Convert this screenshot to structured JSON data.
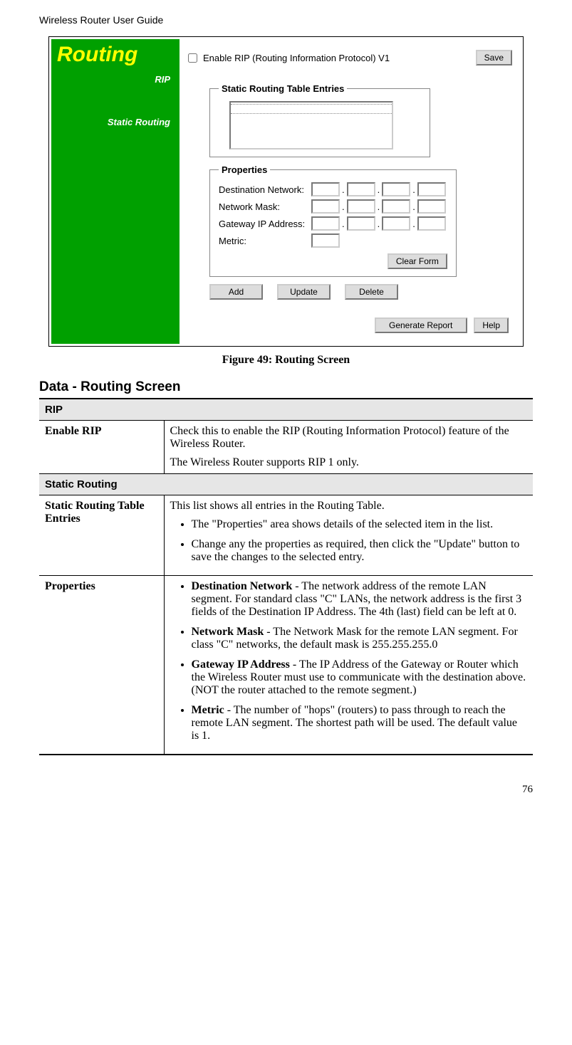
{
  "header": "Wireless Router User Guide",
  "figure": {
    "title": "Routing",
    "side_rip": "RIP",
    "side_static": "Static Routing",
    "rip_checkbox_label": "Enable RIP (Routing Information Protocol) V1",
    "save_btn": "Save",
    "fieldset1_legend": "Static Routing Table Entries",
    "fieldset2_legend": "Properties",
    "prop_dest": "Destination Network:",
    "prop_mask": "Network Mask:",
    "prop_gw": "Gateway IP Address:",
    "prop_metric": "Metric:",
    "clear_btn": "Clear Form",
    "add_btn": "Add",
    "update_btn": "Update",
    "delete_btn": "Delete",
    "report_btn": "Generate Report",
    "help_btn": "Help"
  },
  "caption": "Figure 49: Routing Screen",
  "section_title": "Data - Routing Screen",
  "table": {
    "sec_rip": "RIP",
    "row_enable_label": "Enable RIP",
    "row_enable_p1": "Check this to enable the RIP (Routing Information Protocol) feature of the Wireless Router.",
    "row_enable_p2": "The Wireless Router supports RIP 1 only.",
    "sec_static": "Static Routing",
    "row_entries_label": "Static Routing Table Entries",
    "row_entries_p1": "This list shows all entries in the Routing Table.",
    "row_entries_b1": "The \"Properties\" area shows details of the selected item in the list.",
    "row_entries_b2": "Change any the properties as required, then click the \"Update\" button to save the changes to the selected entry.",
    "row_props_label": "Properties",
    "row_props_b1_bold": "Destination Network",
    "row_props_b1_rest": " - The network address of the remote LAN segment. For standard class \"C\" LANs, the network address is the first 3 fields of the Destination IP Address. The 4th (last) field can be left at 0.",
    "row_props_b2_bold": "Network Mask",
    "row_props_b2_rest": " - The Network Mask for the remote LAN segment. For class \"C\" networks, the default mask is 255.255.255.0",
    "row_props_b3_bold": "Gateway IP Address",
    "row_props_b3_rest": " - The IP Address of the Gateway or Router which the Wireless Router must use to communicate with the destination above. (NOT the router attached to the remote segment.)",
    "row_props_b4_bold": "Metric",
    "row_props_b4_rest": " - The number of \"hops\" (routers) to pass through to reach the remote LAN segment. The shortest path will be used. The default value is 1."
  },
  "page_number": "76"
}
